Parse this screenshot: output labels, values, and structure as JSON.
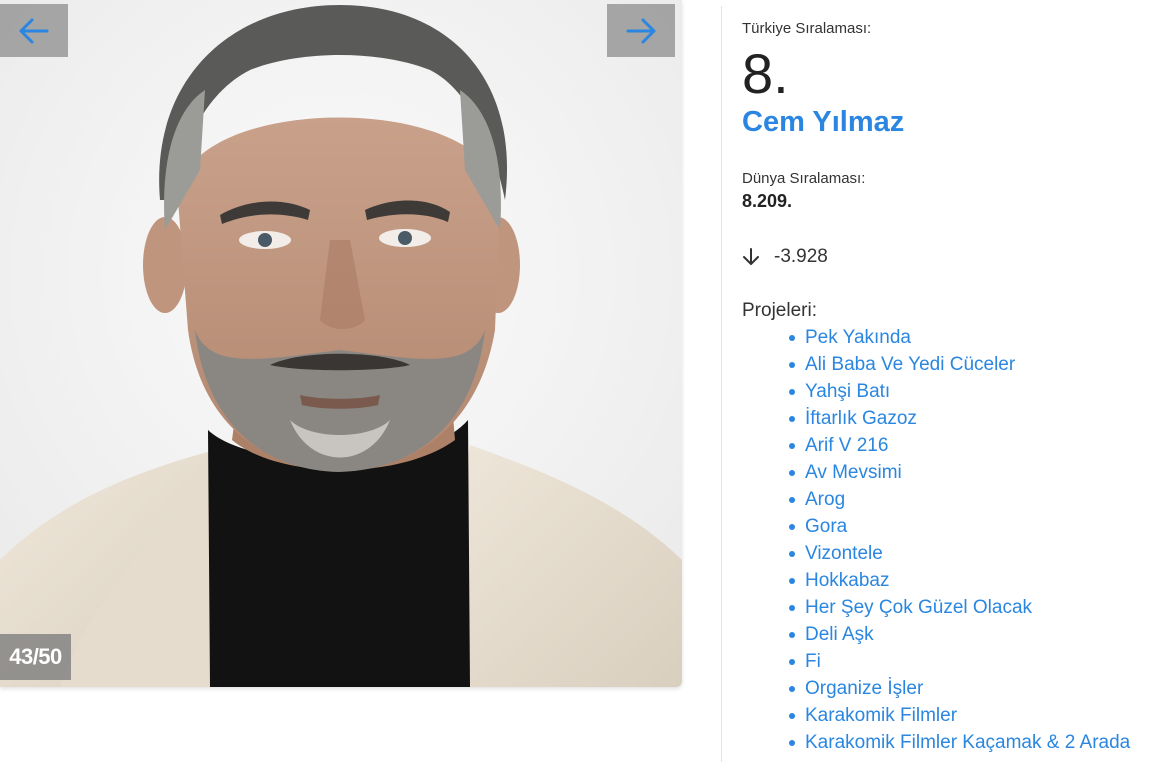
{
  "gallery": {
    "counter": "43/50",
    "prev_icon": "arrow-left-icon",
    "next_icon": "arrow-right-icon"
  },
  "person": {
    "turkey_rank_label": "Türkiye Sıralaması:",
    "turkey_rank": "8.",
    "name": "Cem Yılmaz",
    "world_rank_label": "Dünya Sıralaması:",
    "world_rank": "8.209.",
    "change_icon": "arrow-down-icon",
    "change": "-3.928",
    "projects_label": "Projeleri:",
    "projects": [
      "Pek Yakında",
      "Ali Baba Ve Yedi Cüceler",
      "Yahşi Batı",
      "İftarlık Gazoz",
      "Arif V 216",
      "Av Mevsimi",
      "Arog",
      "Gora",
      "Vizontele",
      "Hokkabaz",
      "Her Şey Çok Güzel Olacak",
      "Deli Aşk",
      "Fi",
      "Organize İşler",
      "Karakomik Filmler",
      "Karakomik Filmler Kaçamak & 2 Arada"
    ]
  },
  "colors": {
    "accent": "#2a86e0",
    "nav_bg": "#8c8c8c"
  }
}
